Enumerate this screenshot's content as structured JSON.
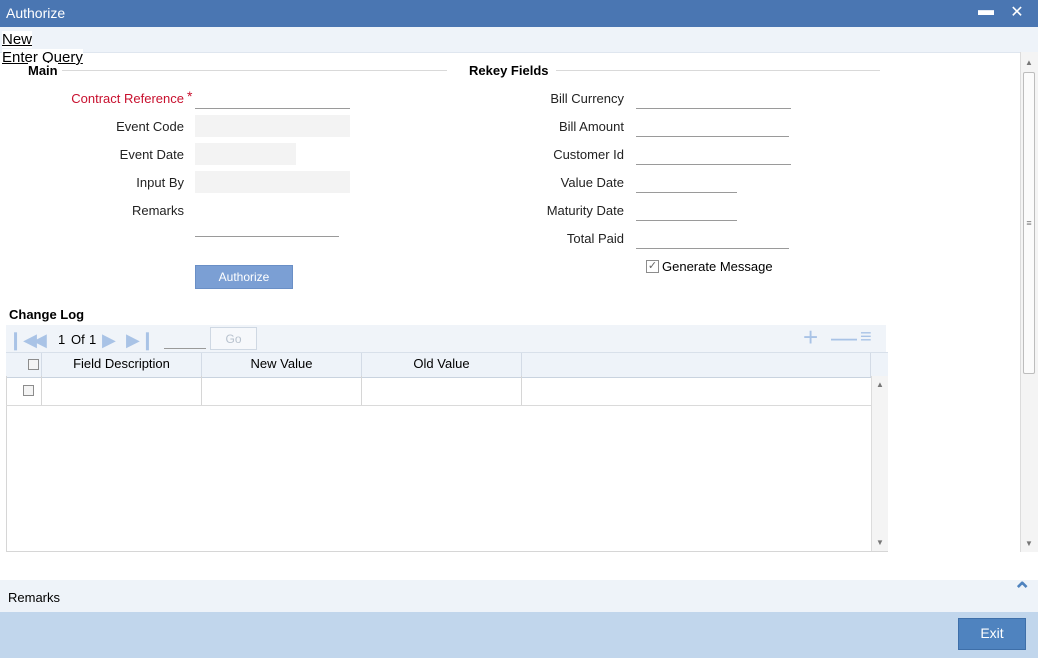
{
  "window": {
    "title": "Authorize",
    "minimize_icon": "minimize-icon",
    "close_icon": "close-icon"
  },
  "toolbar": {
    "new_label": "New",
    "enter_query_label": "Enter Query"
  },
  "main": {
    "section_title": "Main",
    "contract_reference": {
      "label": "Contract Reference",
      "required_mark": "*",
      "value": ""
    },
    "event_code": {
      "label": "Event Code",
      "value": ""
    },
    "event_date": {
      "label": "Event Date",
      "value": ""
    },
    "input_by": {
      "label": "Input By",
      "value": ""
    },
    "remarks": {
      "label": "Remarks",
      "value": ""
    },
    "authorize_button": "Authorize"
  },
  "rekey": {
    "section_title": "Rekey Fields",
    "bill_currency": {
      "label": "Bill Currency",
      "value": ""
    },
    "bill_amount": {
      "label": "Bill Amount",
      "value": ""
    },
    "customer_id": {
      "label": "Customer Id",
      "value": ""
    },
    "value_date": {
      "label": "Value Date",
      "value": ""
    },
    "maturity_date": {
      "label": "Maturity Date",
      "value": ""
    },
    "total_paid": {
      "label": "Total Paid",
      "value": ""
    },
    "generate_message": {
      "label": "Generate Message",
      "checked": true
    }
  },
  "change_log": {
    "title": "Change Log",
    "pager": {
      "current": "1",
      "of_label": "Of",
      "total": "1",
      "go_label": "Go",
      "page_input": ""
    },
    "columns": [
      "Field Description",
      "New Value",
      "Old Value"
    ],
    "rows": [
      {
        "field_description": "",
        "new_value": "",
        "old_value": ""
      }
    ]
  },
  "remarks_bar": {
    "label": "Remarks"
  },
  "footer": {
    "exit_label": "Exit"
  },
  "colors": {
    "titlebar": "#4a76b2",
    "required": "#c8102e",
    "button": "#7b9fd4",
    "footer": "#c1d6ec",
    "exit": "#4f83bf"
  }
}
